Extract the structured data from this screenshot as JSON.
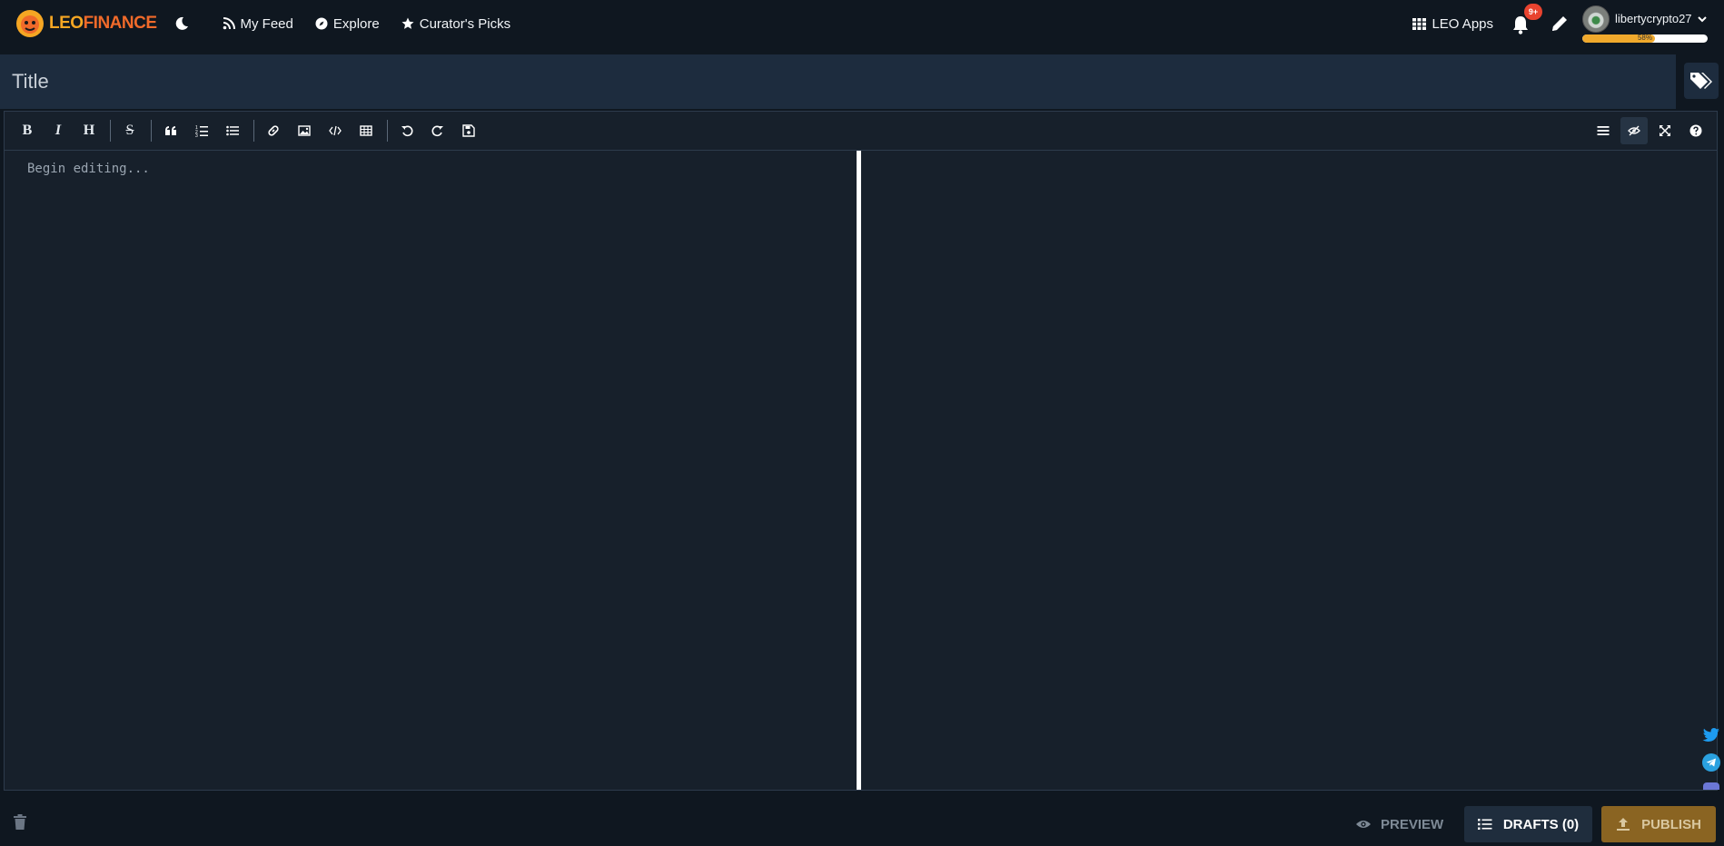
{
  "brand": {
    "leo": "LEO",
    "finance": "FINANCE"
  },
  "nav": {
    "links": [
      {
        "label": "My Feed",
        "icon": "rss-icon"
      },
      {
        "label": "Explore",
        "icon": "compass-icon"
      },
      {
        "label": "Curator's Picks",
        "icon": "star-icon"
      }
    ],
    "apps_label": "LEO Apps",
    "notification_badge": "9+",
    "username": "libertycrypto27",
    "resource_credits_label": "58%",
    "resource_credits_value": 58
  },
  "editor": {
    "title_placeholder": "Title",
    "body_placeholder": "Begin editing..."
  },
  "footer": {
    "preview_label": "PREVIEW",
    "drafts_label": "DRAFTS (0)",
    "publish_label": "PUBLISH"
  },
  "colors": {
    "background": "#0f1720",
    "title_bar": "#1d2c3e",
    "publish": "#8a6422",
    "accent_orange": "#f5a623",
    "badge": "#e8432f"
  }
}
